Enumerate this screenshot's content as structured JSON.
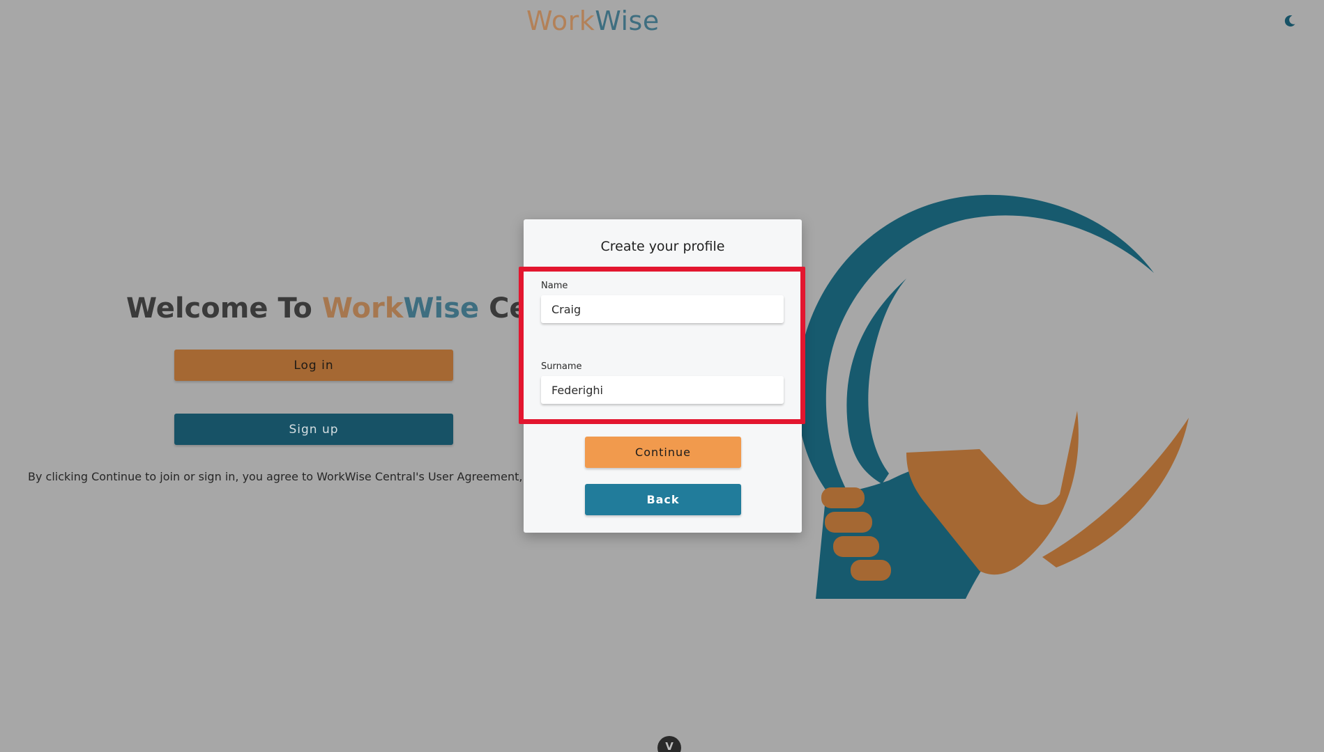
{
  "header": {
    "brand_part1": "Work",
    "brand_part2": "Wise",
    "theme_toggle_icon": "moon-icon"
  },
  "hero": {
    "welcome_prefix": "Welcome To ",
    "welcome_brand1": "Work",
    "welcome_brand2": "Wise",
    "welcome_suffix": " Central",
    "login_label": "Log in",
    "signup_label": "Sign up",
    "legal_text": "By clicking Continue to join or sign in, you agree to WorkWise Central's User Agreement, Privacy Policy"
  },
  "modal": {
    "title": "Create your profile",
    "name_label": "Name",
    "name_value": "Craig",
    "surname_label": "Surname",
    "surname_value": "Federighi",
    "continue_label": "Continue",
    "back_label": "Back"
  },
  "footer": {
    "badge_text": "V"
  },
  "colors": {
    "backdrop": "#a7a7a7",
    "brand_orange": "#f19a4d",
    "brand_teal": "#217c9b",
    "highlight_red": "#e3162f"
  }
}
